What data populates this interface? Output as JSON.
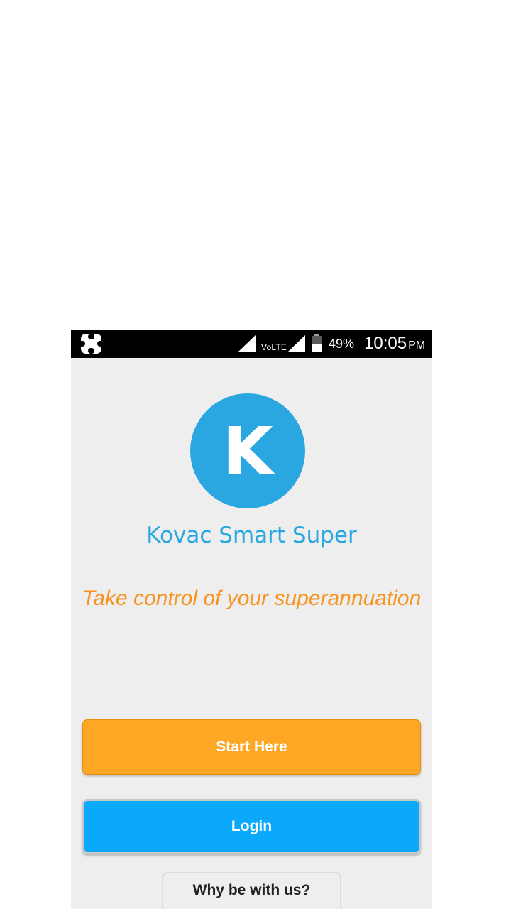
{
  "status_bar": {
    "network_label": "VoLTE",
    "battery_percent": "49%",
    "battery_level": 0.49,
    "time": "10:05",
    "ampm": "PM",
    "icons": [
      "app-notification-icon",
      "signal-icon",
      "signal-icon",
      "battery-icon"
    ]
  },
  "logo": {
    "letter": "K"
  },
  "app": {
    "name": "Kovac Smart Super",
    "tagline": "Take control of your superannuation"
  },
  "buttons": {
    "start": "Start Here",
    "login": "Login",
    "why": "Why be with us?"
  },
  "colors": {
    "brand_blue": "#2aa7e0",
    "tagline_orange": "#f7931e",
    "start_button": "#fda724",
    "login_button": "#0aa9fb",
    "background": "#eeeeee"
  }
}
